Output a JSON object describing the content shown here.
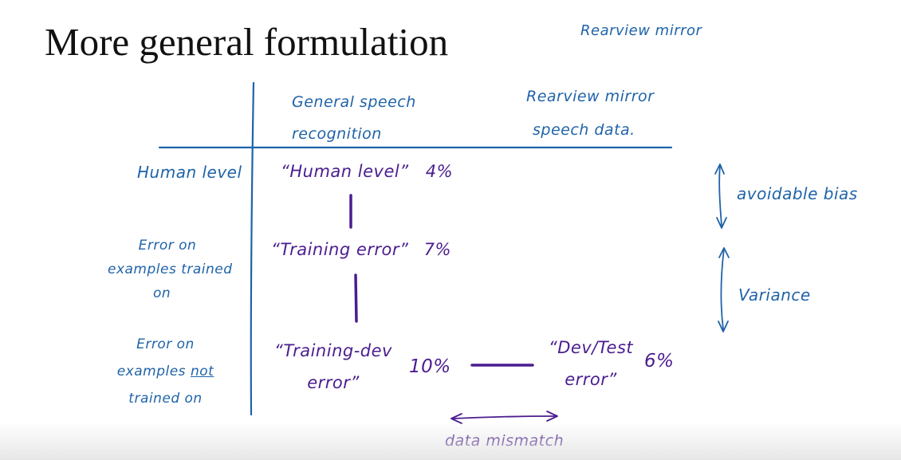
{
  "slide": {
    "title": "More general formulation",
    "top_note": "Rearview mirror"
  },
  "columns": {
    "general": [
      "General speech",
      "recognition"
    ],
    "rearview": [
      "Rearview mirror",
      "speech data."
    ]
  },
  "rows": {
    "human": [
      "Human level"
    ],
    "trained": [
      "Error on",
      "examples trained",
      "on"
    ],
    "not_trained": {
      "line1": "Error on",
      "line2_prefix": "examples",
      "line2_emph": "not",
      "line3": "trained on"
    }
  },
  "cells": {
    "human_level": {
      "label": "“Human level”",
      "value": "4%"
    },
    "training_error": {
      "label": "“Training error”",
      "value": "7%"
    },
    "training_dev": {
      "label": [
        "“Training-dev",
        "error”"
      ],
      "value": "10%"
    },
    "dev_test": {
      "label": [
        "“Dev/Test",
        "error”"
      ],
      "value": "6%"
    }
  },
  "annotations": {
    "avoidable_bias": "avoidable bias",
    "variance": "Variance",
    "data_mismatch": "data mismatch"
  },
  "colors": {
    "grid_blue": "#1f63a8",
    "ink_purple": "#4b1d8f",
    "title_black": "#111111"
  }
}
